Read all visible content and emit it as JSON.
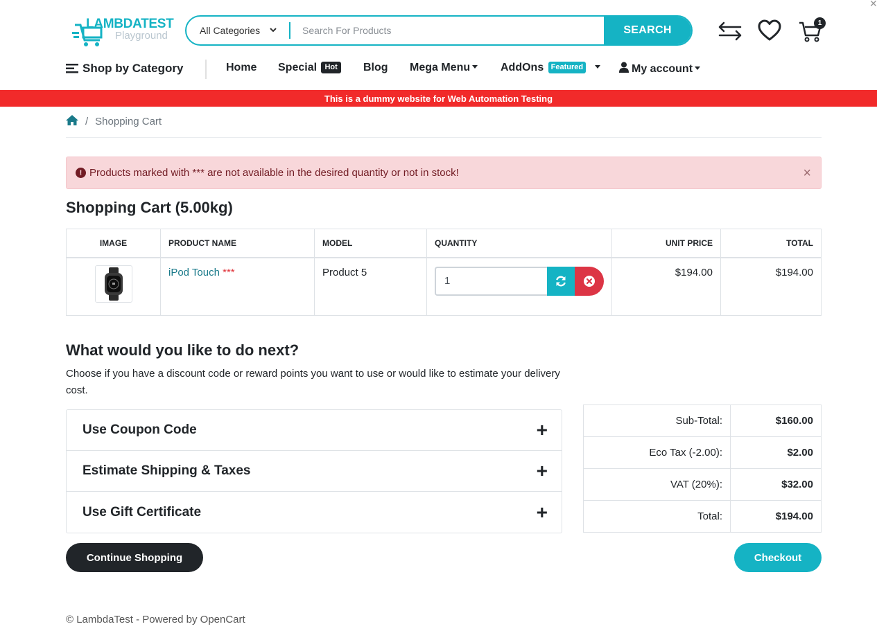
{
  "header": {
    "logo_text": "LAMBDATEST",
    "logo_sub": "Playground",
    "search": {
      "category": "All Categories",
      "placeholder": "Search For Products",
      "button": "SEARCH"
    },
    "cart_count": "1"
  },
  "nav": {
    "shop_by_category": "Shop by Category",
    "items": [
      {
        "label": "Home"
      },
      {
        "label": "Special",
        "badge": "Hot"
      },
      {
        "label": "Blog"
      },
      {
        "label": "Mega Menu"
      },
      {
        "label": "AddOns",
        "badge": "Featured"
      },
      {
        "label": "My account"
      }
    ]
  },
  "banner": "This is a dummy website for Web Automation Testing",
  "breadcrumb": {
    "current": "Shopping Cart"
  },
  "alert": {
    "message": "Products marked with *** are not available in the desired quantity or not in stock!",
    "close": "×"
  },
  "cart": {
    "title": "Shopping Cart  (5.00kg)",
    "columns": [
      "IMAGE",
      "PRODUCT NAME",
      "MODEL",
      "QUANTITY",
      "UNIT PRICE",
      "TOTAL"
    ],
    "rows": [
      {
        "name": "iPod Touch",
        "marker": "***",
        "model": "Product 5",
        "quantity": "1",
        "unit_price": "$194.00",
        "total": "$194.00"
      }
    ]
  },
  "next": {
    "title": "What would you like to do next?",
    "description": "Choose if you have a discount code or reward points you want to use or would like to estimate your delivery cost.",
    "options": [
      "Use Coupon Code",
      "Estimate Shipping & Taxes",
      "Use Gift Certificate"
    ]
  },
  "totals": [
    {
      "label": "Sub-Total:",
      "value": "$160.00"
    },
    {
      "label": "Eco Tax (-2.00):",
      "value": "$2.00"
    },
    {
      "label": "VAT (20%):",
      "value": "$32.00"
    },
    {
      "label": "Total:",
      "value": "$194.00"
    }
  ],
  "buttons": {
    "continue": "Continue Shopping",
    "checkout": "Checkout"
  },
  "footer": "© LambdaTest - Powered by OpenCart",
  "colors": {
    "accent": "#15b3c4",
    "danger": "#dc3545",
    "banner": "#f12a2a",
    "dark": "#212529"
  }
}
